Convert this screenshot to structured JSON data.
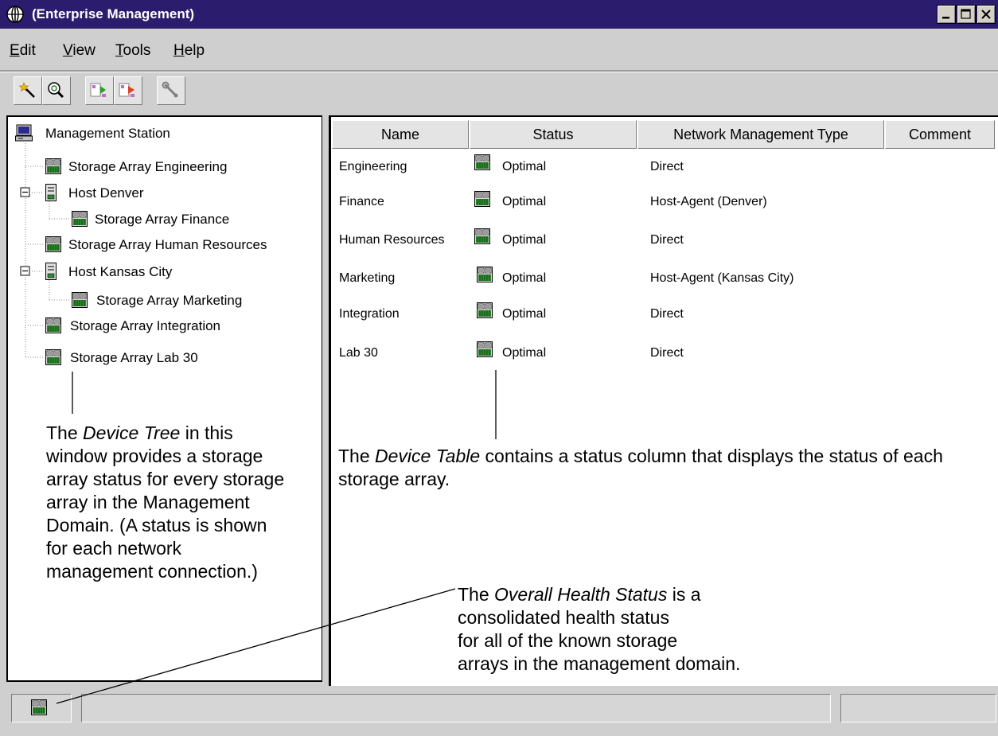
{
  "window": {
    "title": "(Enterprise Management)"
  },
  "menu": [
    {
      "accel": "E",
      "rest": "dit"
    },
    {
      "accel": "V",
      "rest": "iew"
    },
    {
      "accel": "T",
      "rest": "ools"
    },
    {
      "accel": "H",
      "rest": "elp"
    }
  ],
  "toolbar": {
    "buttons": [
      "automatic-discovery-icon",
      "rescan-icon",
      "add-device-icon",
      "remove-device-icon",
      "configure-alerts-icon"
    ]
  },
  "tree": {
    "root": "Management Station",
    "items": [
      "Storage Array Engineering",
      "Host Denver",
      "Storage Array Finance",
      "Storage Array Human Resources",
      "Host Kansas City",
      "Storage Array Marketing",
      "Storage Array Integration",
      "Storage Array Lab 30"
    ]
  },
  "table": {
    "columns": [
      "Name",
      "Status",
      "Network Management Type",
      "Comment"
    ],
    "rows": [
      {
        "name": "Engineering",
        "status": "Optimal",
        "type": "Direct",
        "comment": ""
      },
      {
        "name": "Finance",
        "status": "Optimal",
        "type": "Host-Agent (Denver)",
        "comment": ""
      },
      {
        "name": "Human Resources",
        "status": "Optimal",
        "type": "Direct",
        "comment": ""
      },
      {
        "name": "Marketing",
        "status": "Optimal",
        "type": "Host-Agent (Kansas City)",
        "comment": ""
      },
      {
        "name": "Integration",
        "status": "Optimal",
        "type": "Direct",
        "comment": ""
      },
      {
        "name": "Lab 30",
        "status": "Optimal",
        "type": "Direct",
        "comment": ""
      }
    ]
  },
  "annotations": {
    "tree_pre": "The ",
    "tree_em": "Device Tree",
    "tree_post": " in this window provides a storage array status for every storage array in the Management Domain. (A status is shown for each network management connection.)",
    "table_pre": "The ",
    "table_em": "Device Table",
    "table_post": " contains a status column that displays the status of each storage array.",
    "health_pre": "The ",
    "health_em": "Overall Health Status",
    "health_post": " is a",
    "health_line2": "consolidated health status",
    "health_line3": "for all of the known storage",
    "health_line4": "arrays in the management domain."
  },
  "colors": {
    "titlebar": "#2c1c6e",
    "array_green": "#2e8b2e"
  }
}
